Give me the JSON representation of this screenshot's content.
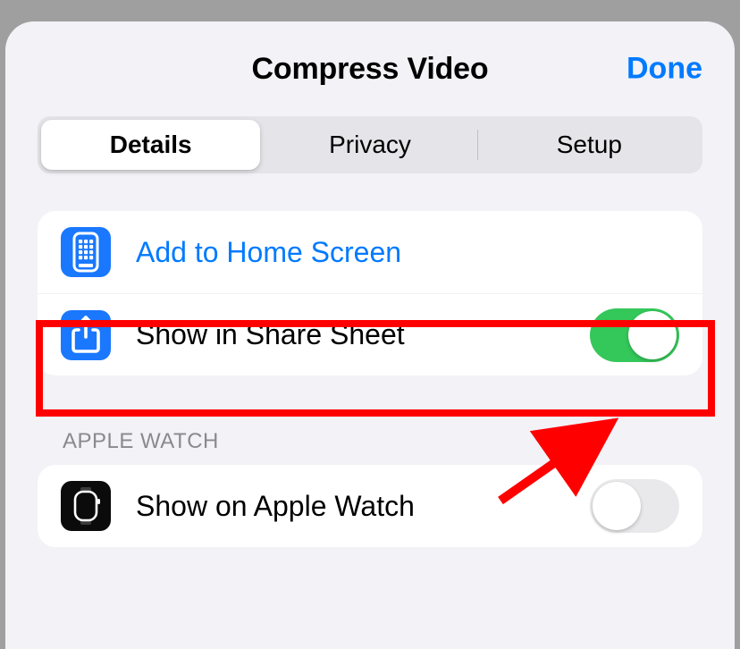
{
  "header": {
    "title": "Compress Video",
    "done_label": "Done"
  },
  "tabs": {
    "items": [
      "Details",
      "Privacy",
      "Setup"
    ],
    "selected_index": 0
  },
  "details_list": {
    "add_home_label": "Add to Home Screen",
    "share_sheet_label": "Show in Share Sheet",
    "share_sheet_on": true
  },
  "watch_section": {
    "header": "APPLE WATCH",
    "show_on_watch_label": "Show on Apple Watch",
    "show_on_watch_on": false
  },
  "colors": {
    "accent_blue": "#007aff",
    "toggle_green": "#34c759",
    "annotation_red": "#ff0000"
  }
}
